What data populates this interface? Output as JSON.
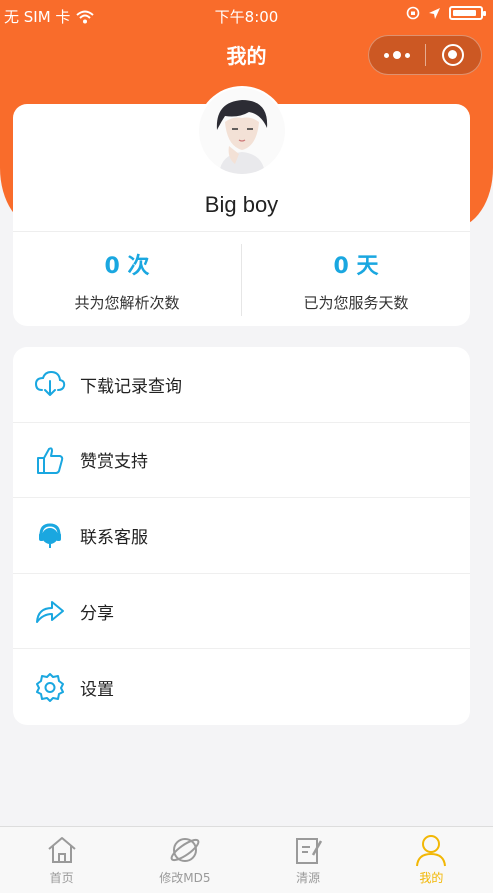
{
  "status_bar": {
    "carrier": "无 SIM 卡",
    "time": "下午8:00"
  },
  "nav": {
    "title": "我的"
  },
  "profile": {
    "username": "Big boy"
  },
  "stats": [
    {
      "value": "0 次",
      "label": "共为您解析次数"
    },
    {
      "value": "0 天",
      "label": "已为您服务天数"
    }
  ],
  "menu": [
    {
      "label": "下载记录查询",
      "icon": "cloud-download-icon"
    },
    {
      "label": "赞赏支持",
      "icon": "thumbs-up-icon"
    },
    {
      "label": "联系客服",
      "icon": "headset-icon"
    },
    {
      "label": "分享",
      "icon": "share-arrow-icon"
    },
    {
      "label": "设置",
      "icon": "settings-gear-icon"
    }
  ],
  "tabs": [
    {
      "label": "首页",
      "icon": "home-icon"
    },
    {
      "label": "修改MD5",
      "icon": "planet-icon"
    },
    {
      "label": "清源",
      "icon": "edit-icon"
    },
    {
      "label": "我的",
      "icon": "user-icon",
      "active": true
    }
  ],
  "colors": {
    "header": "#f96c2b",
    "accent": "#1aa7e0",
    "tab_active": "#f2b705"
  },
  "battery_level": 0.9
}
